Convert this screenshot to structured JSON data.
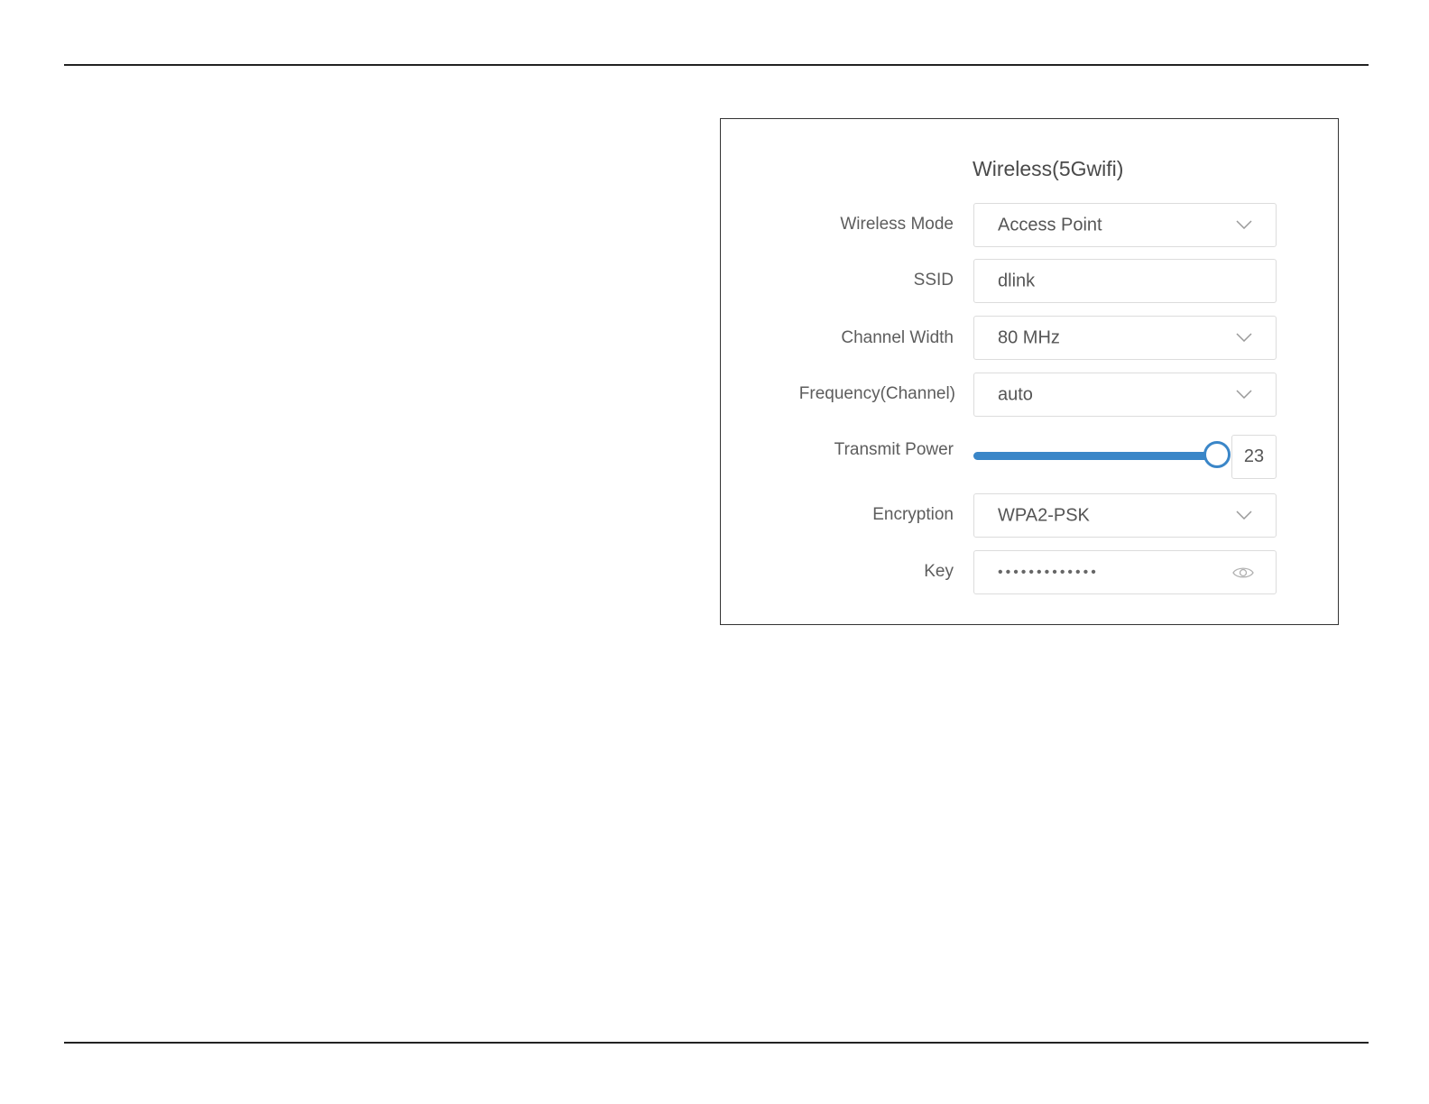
{
  "panel": {
    "title": "Wireless(5Gwifi)"
  },
  "fields": {
    "wireless_mode": {
      "label": "Wireless Mode",
      "value": "Access Point"
    },
    "ssid": {
      "label": "SSID",
      "value": "dlink"
    },
    "channel_width": {
      "label": "Channel Width",
      "value": "80 MHz"
    },
    "frequency": {
      "label": "Frequency(Channel)",
      "value": "auto"
    },
    "transmit_power": {
      "label": "Transmit Power",
      "value": "23",
      "fraction": 1.0
    },
    "encryption": {
      "label": "Encryption",
      "value": "WPA2-PSK"
    },
    "key": {
      "label": "Key",
      "value": "•••••••••••••"
    }
  },
  "icons": {
    "dropdown": "chevron-down-icon",
    "show_password": "eye-icon"
  },
  "colors": {
    "slider_accent": "#3a86c8",
    "field_border": "#dcdcdc"
  }
}
